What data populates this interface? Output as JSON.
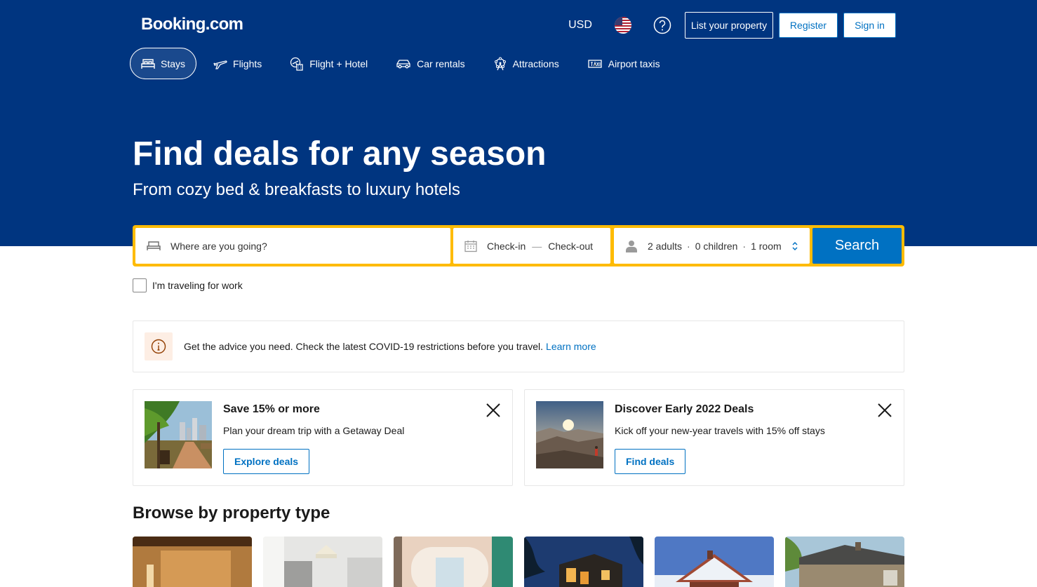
{
  "header": {
    "logo": "Booking.com",
    "currency": "USD",
    "list_property": "List your property",
    "register": "Register",
    "sign_in": "Sign in"
  },
  "nav": {
    "stays": "Stays",
    "flights": "Flights",
    "flight_hotel": "Flight + Hotel",
    "car_rentals": "Car rentals",
    "attractions": "Attractions",
    "airport_taxis": "Airport taxis"
  },
  "hero": {
    "title": "Find deals for any season",
    "subtitle": "From cozy bed & breakfasts to luxury hotels"
  },
  "search": {
    "destination_placeholder": "Where are you going?",
    "check_in": "Check-in",
    "check_out": "Check-out",
    "adults": "2 adults",
    "children": "0 children",
    "rooms": "1 room",
    "search_button": "Search",
    "work_travel": "I'm traveling for work"
  },
  "covid": {
    "text": "Get the advice you need. Check the latest COVID-19 restrictions before you travel.",
    "link": "Learn more"
  },
  "deals": [
    {
      "title": "Save 15% or more",
      "text": "Plan your dream trip with a Getaway Deal",
      "button": "Explore deals"
    },
    {
      "title": "Discover Early 2022 Deals",
      "text": "Kick off your new-year travels with 15% off stays",
      "button": "Find deals"
    }
  ],
  "browse": {
    "title": "Browse by property type"
  },
  "colors": {
    "brand_blue": "#003580",
    "action_blue": "#0071c2",
    "search_yellow": "#febb02"
  }
}
